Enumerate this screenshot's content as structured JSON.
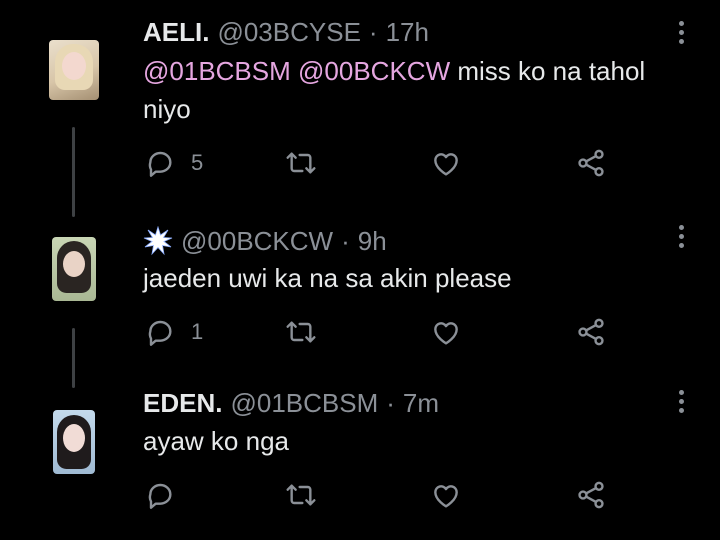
{
  "tweets": [
    {
      "name": "AELI.",
      "handle": "@03BCYSE",
      "separator": "·",
      "time": "17h",
      "mentions": [
        "@01BCBSM",
        "@00BCKCW"
      ],
      "text": "miss ko na tahol niyo",
      "reply_count": "5",
      "avatar_colors": [
        "#e9ddc9",
        "#f0d6d0"
      ]
    },
    {
      "name": "",
      "handle": "@00BCKCW",
      "separator": "·",
      "time": "9h",
      "text": "jaeden uwi ka na sa akin please",
      "reply_count": "1",
      "avatar_colors": [
        "#c7d4b2",
        "#2a2522"
      ]
    },
    {
      "name": "EDEN.",
      "handle": "@01BCBSM",
      "separator": "·",
      "time": "7m",
      "text": "ayaw ko nga",
      "reply_count": "",
      "avatar_colors": [
        "#b7d0e6",
        "#1f1b1c"
      ]
    }
  ],
  "icons": {
    "reply": "reply-icon",
    "retweet": "retweet-icon",
    "like": "heart-icon",
    "share": "share-icon",
    "more": "more-icon"
  },
  "colors": {
    "background": "#000000",
    "text": "#e7e9ea",
    "muted": "#8b9097",
    "mention": "#e5a6e0",
    "thread_line": "#3e4144"
  }
}
